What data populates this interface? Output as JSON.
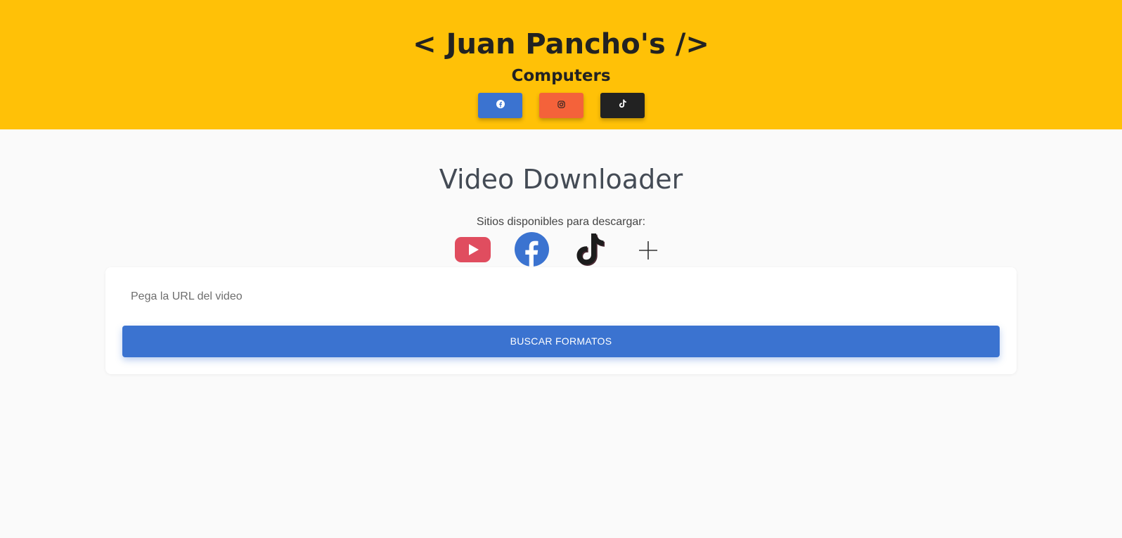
{
  "header": {
    "title": "< Juan Pancho's />",
    "subtitle": "Computers",
    "social_links": [
      {
        "name": "facebook-icon",
        "color": "#3b73d0"
      },
      {
        "name": "instagram-icon",
        "color": "#f4623a"
      },
      {
        "name": "tiktok-icon",
        "color": "#222222"
      }
    ],
    "background_color": "#ffc107"
  },
  "main": {
    "heading": "Video Downloader",
    "sites_label": "Sitios disponibles para descargar:",
    "sites": [
      "youtube-icon",
      "facebook-icon",
      "tiktok-icon",
      "plus-icon"
    ],
    "form": {
      "url_placeholder": "Pega la URL del video",
      "url_value": "",
      "search_button_label": "BUSCAR FORMATOS"
    }
  },
  "colors": {
    "primary": "#3b73d0",
    "accent": "#ffc107",
    "youtube": "#e04d5f",
    "text_dark": "#222222"
  }
}
